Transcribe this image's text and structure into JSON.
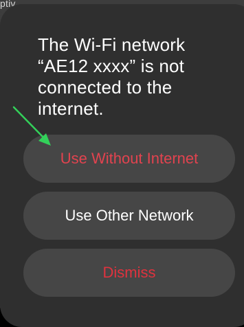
{
  "background": {
    "peek_text": "ptiv"
  },
  "alert": {
    "message": "The Wi-Fi network “AE12 xxxx” is not connected to the internet.",
    "actions": [
      {
        "label": "Use Without Internet",
        "color": "#e2434f"
      },
      {
        "label": "Use Other Network",
        "color": "#ffffff"
      },
      {
        "label": "Dismiss",
        "color": "#e0323e"
      }
    ]
  },
  "annotation": {
    "arrow_color": "#33d15a",
    "arrow_target": "Use Without Internet"
  },
  "colors": {
    "alert_background": "#2f2f2f",
    "button_background": "#464646",
    "message_text": "#ffffff"
  }
}
